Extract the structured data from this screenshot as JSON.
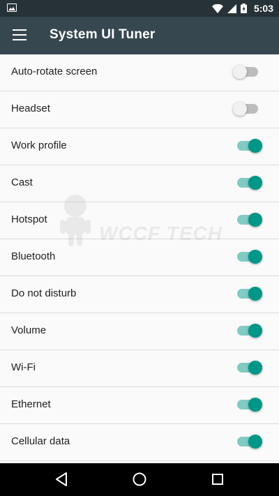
{
  "status_bar": {
    "time": "5:03",
    "icons": [
      "image-icon",
      "wifi-icon",
      "cellular-signal-icon",
      "battery-icon"
    ]
  },
  "app_bar": {
    "title": "System UI Tuner",
    "menu_icon": "menu-icon"
  },
  "settings": [
    {
      "label": "Auto-rotate screen",
      "enabled": false
    },
    {
      "label": "Headset",
      "enabled": false
    },
    {
      "label": "Work profile",
      "enabled": true
    },
    {
      "label": "Cast",
      "enabled": true
    },
    {
      "label": "Hotspot",
      "enabled": true
    },
    {
      "label": "Bluetooth",
      "enabled": true
    },
    {
      "label": "Do not disturb",
      "enabled": true
    },
    {
      "label": "Volume",
      "enabled": true
    },
    {
      "label": "Wi-Fi",
      "enabled": true
    },
    {
      "label": "Ethernet",
      "enabled": true
    },
    {
      "label": "Cellular data",
      "enabled": true
    }
  ],
  "watermark": {
    "text": "WCCF TECH"
  },
  "nav_bar": {
    "icons": [
      "back-icon",
      "home-icon",
      "recents-icon"
    ]
  },
  "colors": {
    "status_bar": "#263238",
    "app_bar": "#37474f",
    "switch_on_thumb": "#009688",
    "switch_on_track": "#80cbc4",
    "switch_off_thumb": "#f1f1f1",
    "switch_off_track": "#bdbdbd"
  }
}
